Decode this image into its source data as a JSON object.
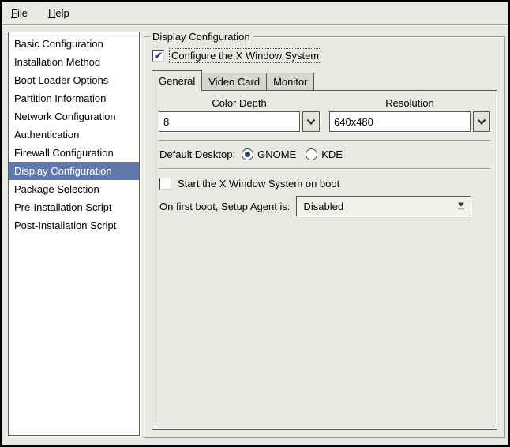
{
  "menubar": {
    "items": [
      {
        "label": "File",
        "mnemonic": "F"
      },
      {
        "label": "Help",
        "mnemonic": "H"
      }
    ]
  },
  "sidebar": {
    "selected_index": 7,
    "selected_bg": "#6079ac",
    "items": [
      {
        "label": "Basic Configuration",
        "selected": false
      },
      {
        "label": "Installation Method",
        "selected": false
      },
      {
        "label": "Boot Loader Options",
        "selected": false
      },
      {
        "label": "Partition Information",
        "selected": false
      },
      {
        "label": "Network Configuration",
        "selected": false
      },
      {
        "label": "Authentication",
        "selected": false
      },
      {
        "label": "Firewall Configuration",
        "selected": false
      },
      {
        "label": "Display Configuration",
        "selected": true
      },
      {
        "label": "Package Selection",
        "selected": false
      },
      {
        "label": "Pre-Installation Script",
        "selected": false
      },
      {
        "label": "Post-Installation Script",
        "selected": false
      }
    ]
  },
  "main": {
    "frame_title": "Display Configuration",
    "configure_x": {
      "label": "Configure the X Window System",
      "checked": true
    },
    "tabs": [
      {
        "label": "General",
        "active": true
      },
      {
        "label": "Video Card",
        "active": false
      },
      {
        "label": "Monitor",
        "active": false
      }
    ],
    "general": {
      "color_depth": {
        "label": "Color Depth",
        "value": "8"
      },
      "resolution": {
        "label": "Resolution",
        "value": "640x480"
      },
      "default_desktop": {
        "label": "Default Desktop:",
        "options": [
          {
            "label": "GNOME",
            "selected": true
          },
          {
            "label": "KDE",
            "selected": false
          }
        ]
      },
      "start_x": {
        "label": "Start the X Window System on boot",
        "checked": false
      },
      "setup_agent": {
        "label": "On first boot, Setup Agent is:",
        "value": "Disabled"
      }
    }
  },
  "icons": {
    "check": "✔"
  },
  "colors": {
    "window_bg": "#e8e8e5",
    "selection_bg": "#6079ac",
    "accent_check": "#2b3c6e"
  }
}
